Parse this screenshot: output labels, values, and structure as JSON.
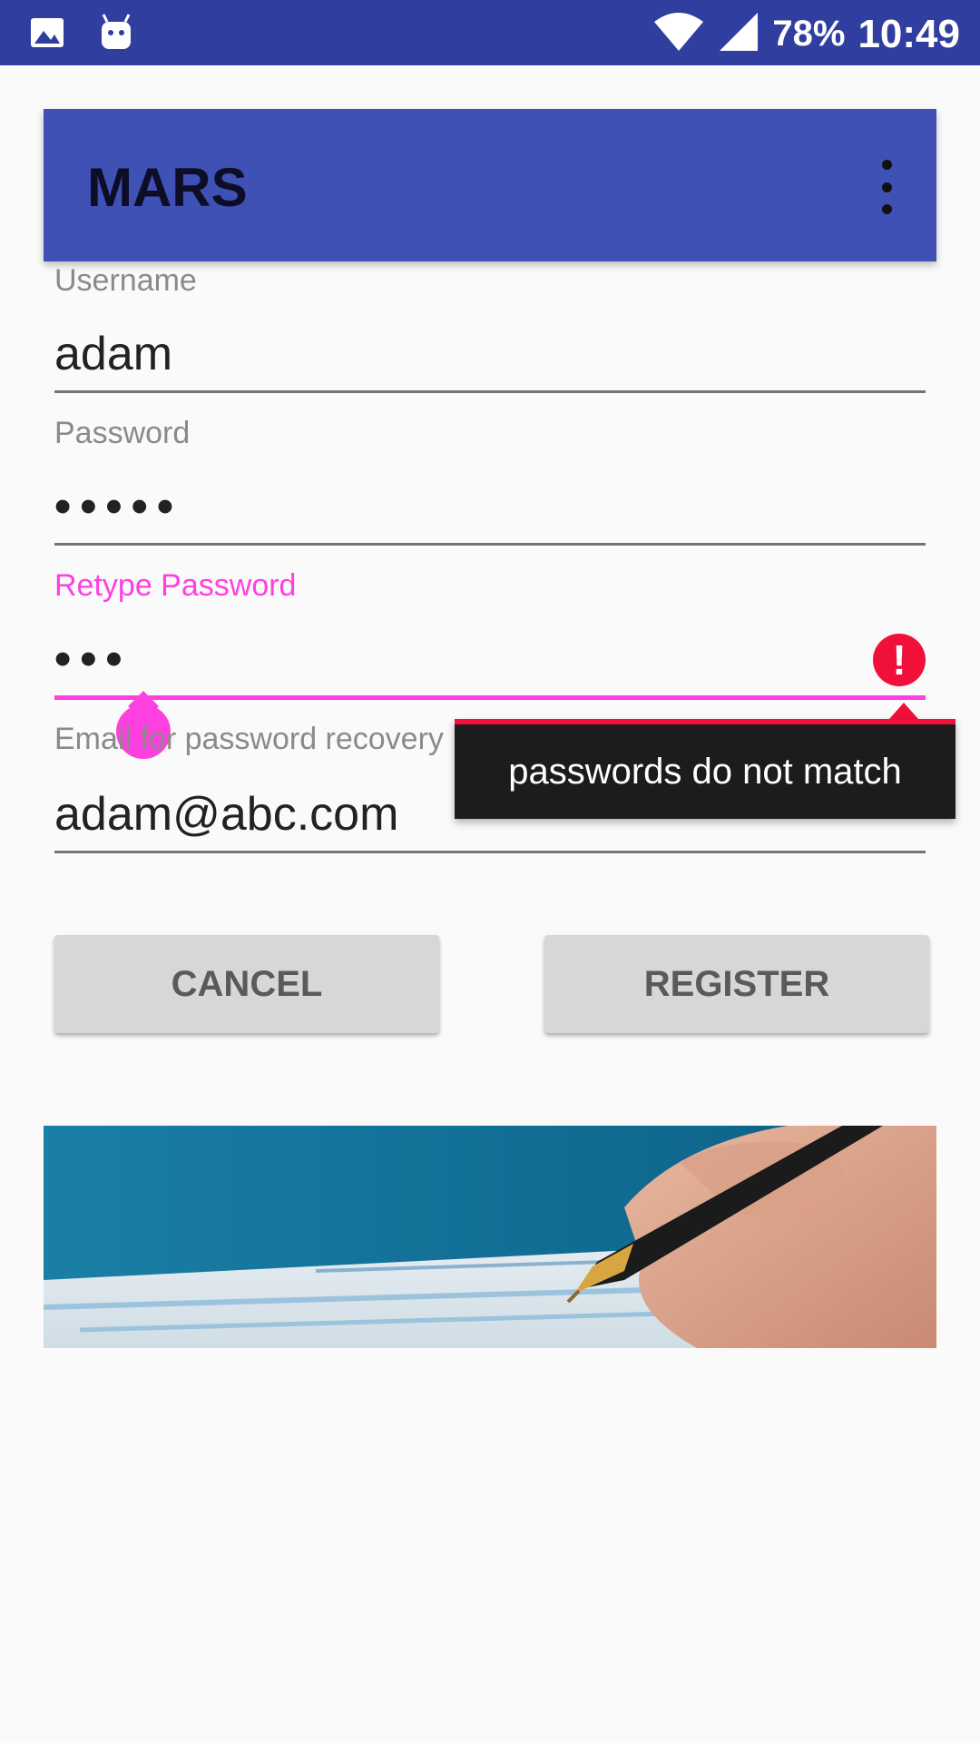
{
  "status_bar": {
    "battery": "78%",
    "time": "10:49",
    "icons": [
      "image-icon",
      "android-icon",
      "wifi-icon",
      "signal-icon"
    ]
  },
  "app_bar": {
    "title": "MARS",
    "overflow_icon": "more-vert-icon"
  },
  "form": {
    "username": {
      "label": "Username",
      "value": "adam"
    },
    "password": {
      "label": "Password",
      "value": "•••••"
    },
    "retype_password": {
      "label": "Retype Password",
      "value": "•••",
      "error": "passwords do not match"
    },
    "email": {
      "label": "Email for password recovery",
      "value": "adam@abc.com"
    }
  },
  "buttons": {
    "cancel": "CANCEL",
    "register": "REGISTER"
  },
  "colors": {
    "status_bar": "#303f9f",
    "app_bar": "#3f51b5",
    "accent": "#ff40e0",
    "error": "#f0103a"
  }
}
